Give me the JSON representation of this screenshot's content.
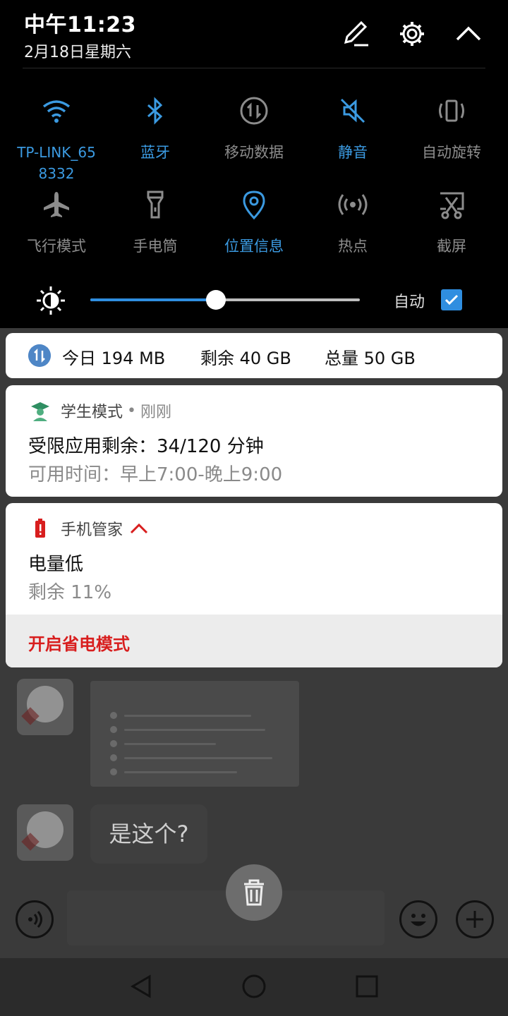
{
  "status": {
    "time": "中午11:23",
    "date": "2月18日星期六"
  },
  "header_icons": [
    "edit-icon",
    "settings-icon",
    "collapse-icon"
  ],
  "quick_settings": {
    "tiles": [
      {
        "id": "wifi",
        "label": "TP-LINK_658332",
        "active": true,
        "icon": "wifi-icon"
      },
      {
        "id": "bluetooth",
        "label": "蓝牙",
        "active": true,
        "icon": "bluetooth-icon"
      },
      {
        "id": "mobile-data",
        "label": "移动数据",
        "active": false,
        "icon": "mobile-data-icon"
      },
      {
        "id": "mute",
        "label": "静音",
        "active": true,
        "icon": "mute-icon"
      },
      {
        "id": "auto-rotate",
        "label": "自动旋转",
        "active": false,
        "icon": "rotate-icon"
      },
      {
        "id": "airplane",
        "label": "飞行模式",
        "active": false,
        "icon": "airplane-icon"
      },
      {
        "id": "flashlight",
        "label": "手电筒",
        "active": false,
        "icon": "flashlight-icon"
      },
      {
        "id": "location",
        "label": "位置信息",
        "active": true,
        "icon": "location-icon"
      },
      {
        "id": "hotspot",
        "label": "热点",
        "active": false,
        "icon": "hotspot-icon"
      },
      {
        "id": "screenshot",
        "label": "截屏",
        "active": false,
        "icon": "screenshot-icon"
      }
    ],
    "brightness": {
      "level_fraction": 0.465,
      "auto_label": "自动",
      "auto_checked": true
    }
  },
  "data_usage": {
    "today": "今日 194 MB",
    "remaining": "剩余 40 GB",
    "total": "总量 50 GB"
  },
  "notifications": {
    "student": {
      "app": "学生模式",
      "when": "刚刚",
      "title": "受限应用剩余：34/120 分钟",
      "subtitle": "可用时间：早上7:00-晚上9:00"
    },
    "manager": {
      "app": "手机管家",
      "title": "电量低",
      "subtitle": "剩余 11%",
      "action": "开启省电模式"
    }
  },
  "chat": {
    "message": "是这个?"
  },
  "colors": {
    "accent": "#2f8ee0",
    "warning": "#d81e1e",
    "shade_bg": "#000000"
  }
}
